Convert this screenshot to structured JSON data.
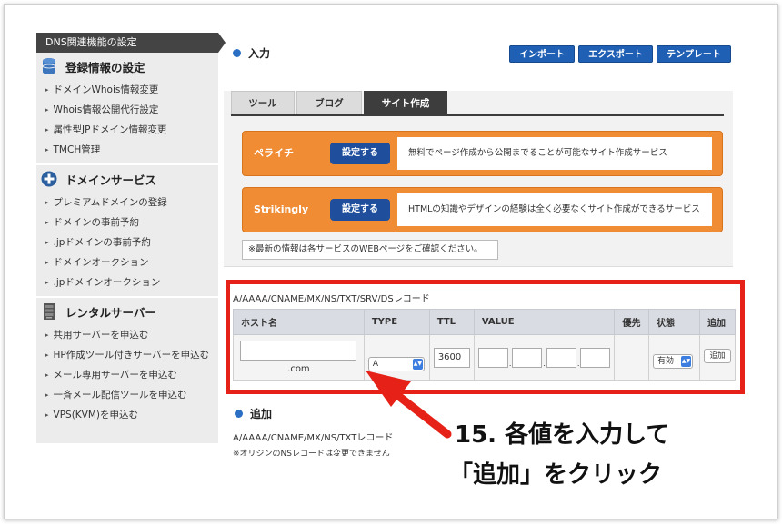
{
  "sidebar": {
    "current": "DNS関連機能の設定",
    "sections": [
      {
        "title": "登録情報の設定",
        "icon": "database-icon",
        "items": [
          "ドメインWhois情報変更",
          "Whois情報公開代行設定",
          "属性型JPドメイン情報変更",
          "TMCH管理"
        ]
      },
      {
        "title": "ドメインサービス",
        "icon": "plus-circle-icon",
        "items": [
          "プレミアムドメインの登録",
          "ドメインの事前予約",
          ".jpドメインの事前予約",
          "ドメインオークション",
          ".jpドメインオークション"
        ]
      },
      {
        "title": "レンタルサーバー",
        "icon": "server-icon",
        "items": [
          "共用サーバーを申込む",
          "HP作成ツール付きサーバーを申込む",
          "メール専用サーバーを申込む",
          "一斉メール配信ツールを申込む",
          "VPS(KVM)を申込む"
        ]
      }
    ]
  },
  "main": {
    "input_title": "入力",
    "top_buttons": [
      "インポート",
      "エクスポート",
      "テンプレート"
    ],
    "tabs": [
      "ツール",
      "ブログ",
      "サイト作成"
    ],
    "services": [
      {
        "name": "ペライチ",
        "button": "設定する",
        "desc": "無料でページ作成から公開までることが可能なサイト作成サービス"
      },
      {
        "name": "Strikingly",
        "button": "設定する",
        "desc": "HTMLの知識やデザインの経験は全く必要なくサイト作成ができるサービス"
      }
    ],
    "notice": "※最新の情報は各サービスのWEBページをご確認ください。",
    "record_label": "A/AAAA/CNAME/MX/NS/TXT/SRV/DSレコード",
    "table": {
      "headers": [
        "ホスト名",
        "TYPE",
        "TTL",
        "VALUE",
        "優先",
        "状態",
        "追加"
      ],
      "host_value": "",
      "domain_suffix": ".com",
      "type_value": "A",
      "ttl_value": "3600",
      "status_value": "有効",
      "add_button": "追加"
    },
    "add_title": "追加",
    "add_label": "A/AAAA/CNAME/MX/NS/TXTレコード",
    "add_note": "※オリジンのNSレコードは変更できません"
  },
  "callout": {
    "line1": "15. 各値を入力して",
    "line2": "「追加」をクリック",
    "color": "#e62117"
  }
}
